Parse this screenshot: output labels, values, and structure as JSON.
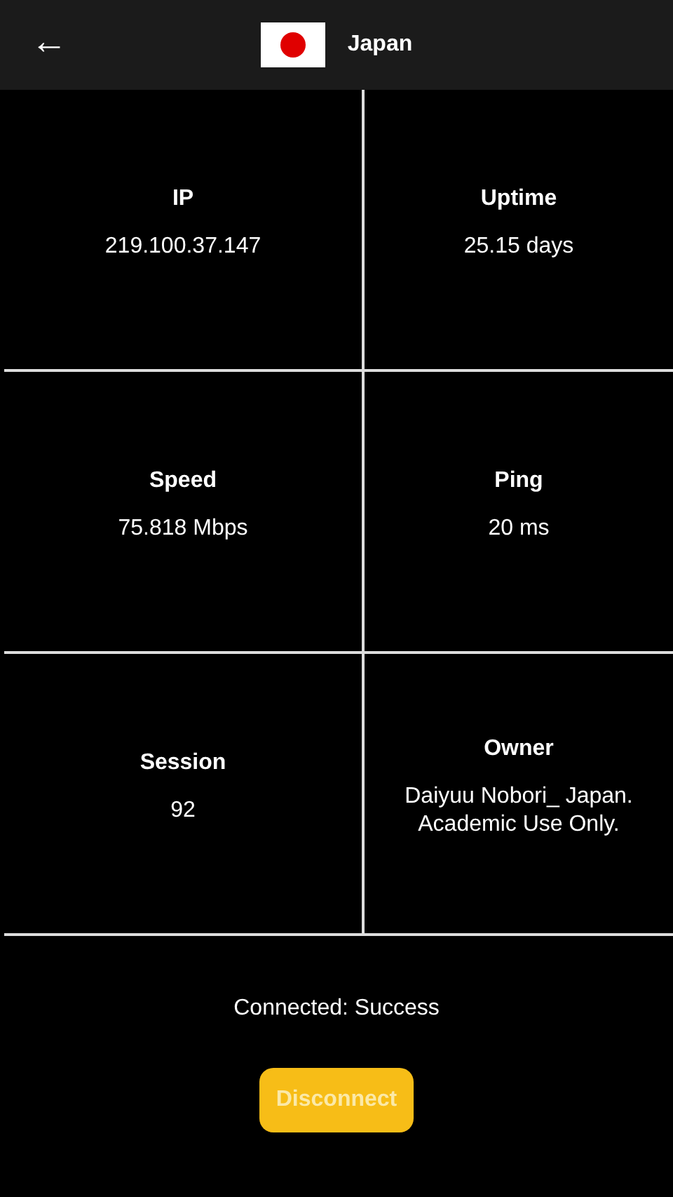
{
  "header": {
    "back": "←",
    "title": "Japan"
  },
  "stats": [
    {
      "label": "IP",
      "value": "219.100.37.147"
    },
    {
      "label": "Uptime",
      "value": "25.15 days"
    },
    {
      "label": "Speed",
      "value": "75.818 Mbps"
    },
    {
      "label": "Ping",
      "value": "20 ms"
    },
    {
      "label": "Session",
      "value": "92"
    },
    {
      "label": "Owner",
      "value": "Daiyuu Nobori_ Japan. Academic Use Only."
    }
  ],
  "status": "Connected: Success",
  "buttons": [
    "Disconnect"
  ]
}
